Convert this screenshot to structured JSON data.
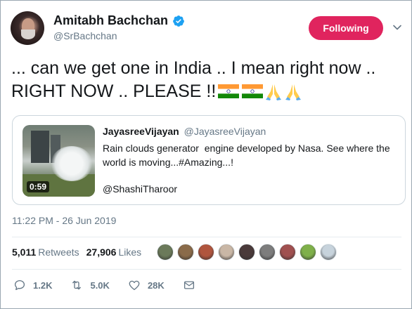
{
  "author": {
    "display_name": "Amitabh Bachchan",
    "handle": "@SrBachchan",
    "verified_icon": "verified-badge-icon",
    "avatar": "avatar-image"
  },
  "follow_button": {
    "label": "Following",
    "color": "#e0245e"
  },
  "tweet": {
    "text": "... can we get one in India .. I mean right now .. RIGHT NOW .. PLEASE !!",
    "emojis": [
      "india-flag-icon",
      "india-flag-icon",
      "folded-hands-icon",
      "folded-hands-icon"
    ]
  },
  "quote": {
    "author_name": "JayasreeVijayan",
    "author_handle": "@JayasreeVijayan",
    "text": "Rain clouds generator  engine developed by Nasa. See where the world is moving...#Amazing...!",
    "mention": "@ShashiTharoor",
    "video_duration": "0:59"
  },
  "timestamp": "11:22 PM - 26 Jun 2019",
  "stats": {
    "retweets_count": "5,011",
    "retweets_label": "Retweets",
    "likes_count": "27,906",
    "likes_label": "Likes"
  },
  "likers": [
    "#6b7a5a",
    "#8a6b4a",
    "#b0553e",
    "#c9b7a6",
    "#4a3a3a",
    "#7d7d7d",
    "#a05050",
    "#7fb04a",
    "#c7d3dc"
  ],
  "actions": {
    "reply_count": "1.2K",
    "retweet_count": "5.0K",
    "like_count": "28K"
  },
  "colors": {
    "text": "#14171a",
    "muted": "#657786",
    "border": "#e6ecf0",
    "accent": "#1da1f2"
  }
}
